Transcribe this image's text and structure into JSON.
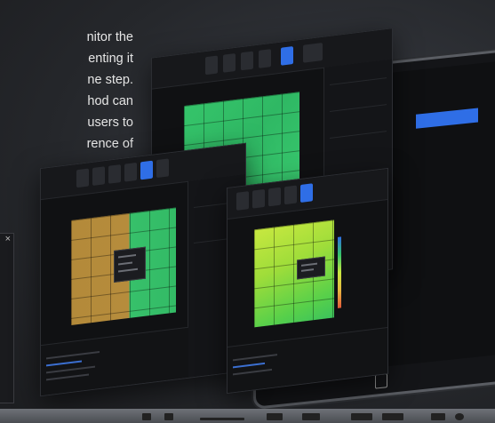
{
  "blurb": {
    "lines": [
      "nitor the",
      "enting it",
      "ne step.",
      "hod can",
      "users to",
      "rence of"
    ]
  },
  "side_dialog": {
    "close_glyph": "×"
  },
  "screens": {
    "right_panel_header": "",
    "blue_tab_label": ""
  },
  "colors": {
    "accent": "#2f6ee6",
    "heat_green": "#35c46a",
    "heat_orange": "#b38a3a",
    "heat_lime": "#c8e840"
  },
  "icons": [
    "close-icon",
    "tablet-home-icon"
  ]
}
